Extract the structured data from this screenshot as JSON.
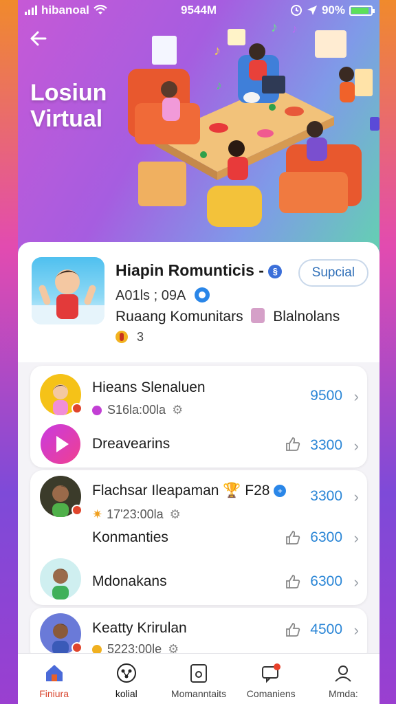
{
  "statusbar": {
    "carrier": "hibanoal",
    "time": "9544M",
    "battery": "90%"
  },
  "hero": {
    "title_line1": "Losiun",
    "title_line2": "Virtual"
  },
  "group": {
    "name": "Hiapin Romunticis -",
    "special_label": "Supcial",
    "id": "A01ls ; 09A",
    "description_left": "Ruaang Komunitars",
    "description_right": "Blalnolans",
    "count": "3"
  },
  "cards": [
    {
      "rows": [
        {
          "name": "Hieans Slenaluen",
          "sub": "S16la:00la",
          "value": "9500"
        },
        {
          "name": "Dreavearins",
          "value": "3300"
        }
      ]
    },
    {
      "rows": [
        {
          "name": "Flachsar Ileapaman",
          "tag": "F28",
          "sub": "17'23:00la",
          "value": "3300"
        },
        {
          "name": "Konmanties",
          "value": "6300"
        },
        {
          "name": "Mdonakans",
          "value": "6300"
        }
      ]
    },
    {
      "rows": [
        {
          "name": "Keatty Krirulan",
          "sub": "5223:00le",
          "value": "4500"
        }
      ]
    }
  ],
  "tabs": [
    {
      "label": "Finiura"
    },
    {
      "label": "kolial"
    },
    {
      "label": "Momanntaits"
    },
    {
      "label": "Comaniens"
    },
    {
      "label": "Mmda:"
    }
  ],
  "colors": {
    "accent": "#2b86d6",
    "active_tab": "#d8442d"
  }
}
